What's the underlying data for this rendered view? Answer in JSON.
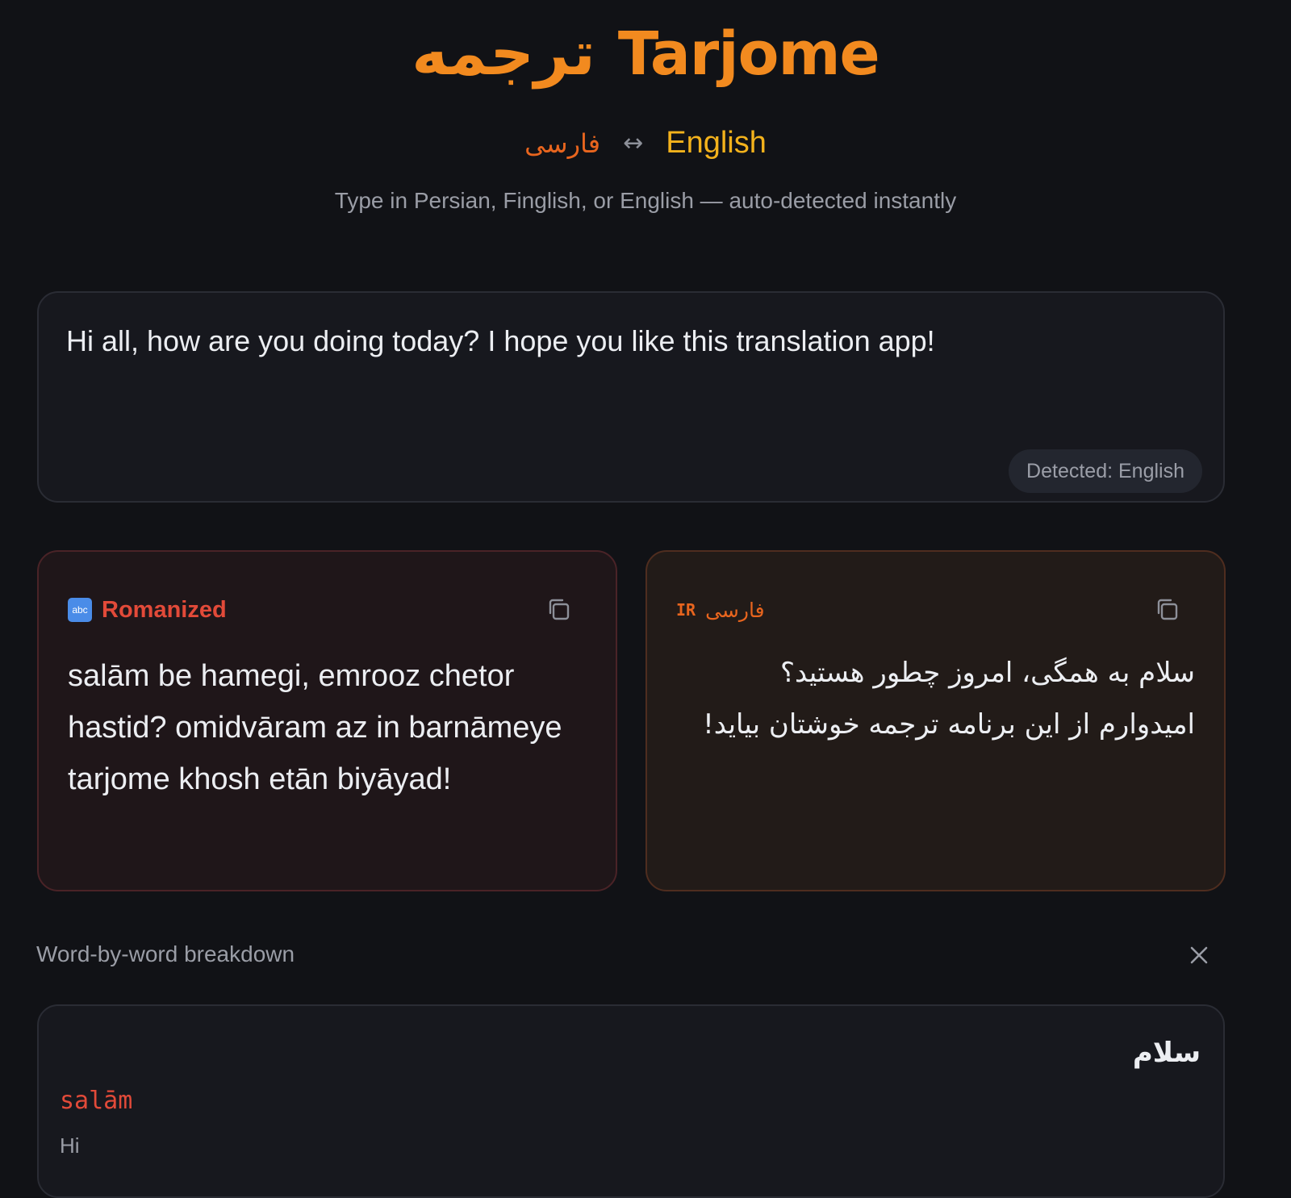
{
  "app": {
    "title_fa": "ترجمه",
    "title_en": "Tarjome",
    "lang_fa": "فارسی",
    "lang_arrow": "↔",
    "lang_en": "English",
    "subtitle": "Type in Persian, Finglish, or English — auto-detected instantly"
  },
  "input": {
    "value": "Hi all, how are you doing today? I hope you like this translation app!",
    "detected_label": "Detected: English"
  },
  "romanized": {
    "icon": "abc",
    "label": "Romanized",
    "text": "salām be hamegi, emrooz chetor hastid? omidvāram az in barnāmeye tarjome khosh etān biyāyad!"
  },
  "farsi": {
    "flag": "IR",
    "label": "فارسی",
    "text": "سلام به همگی، امروز چطور هستید؟ امیدوارم از این برنامه ترجمه خوشتان بیاید!"
  },
  "breakdown": {
    "title": "Word-by-word breakdown",
    "words": [
      {
        "fa": "سلام",
        "roman": "salām",
        "en": "Hi"
      }
    ]
  },
  "colors": {
    "accent_orange": "#f28a1f",
    "accent_red": "#e24a39",
    "accent_yellow": "#f3b21c",
    "background": "#111216"
  }
}
